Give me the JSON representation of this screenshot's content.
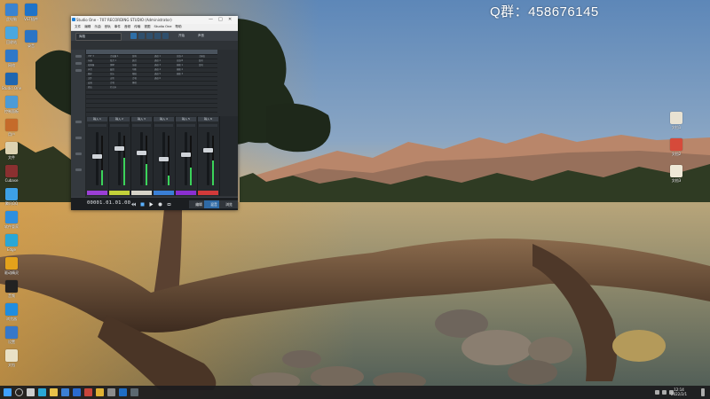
{
  "desktop": {
    "watermark": "Q群：458676145",
    "icons_left": [
      {
        "label": "此电脑",
        "color": "#3a83d1"
      },
      {
        "label": "回收站",
        "color": "#4aa7e0"
      },
      {
        "label": "网络",
        "color": "#2f78c8"
      },
      {
        "label": "Studio One",
        "color": "#1e66b0"
      },
      {
        "label": "控制面板",
        "color": "#4c9bd6"
      },
      {
        "label": "用户",
        "color": "#c56b2a"
      },
      {
        "label": "文件",
        "color": "#ddd3b2"
      },
      {
        "label": "Cubase",
        "color": "#8a3030"
      },
      {
        "label": "腾讯QQ",
        "color": "#3da0e6"
      },
      {
        "label": "软件管家",
        "color": "#2e8fe0"
      },
      {
        "label": "Edge",
        "color": "#2aa7d6"
      },
      {
        "label": "驱动精灵",
        "color": "#e3a21b"
      },
      {
        "label": "音频",
        "color": "#222222"
      },
      {
        "label": "浏览器",
        "color": "#1f8de0"
      },
      {
        "label": "设置",
        "color": "#3778c9"
      },
      {
        "label": "文档",
        "color": "#e9e1c6"
      }
    ],
    "icons_left2": [
      {
        "label": "VST插件",
        "color": "#1e73c9"
      },
      {
        "label": "录音",
        "color": "#2b74c4"
      }
    ],
    "icons_right": [
      {
        "label": "文档1",
        "color": "#e8e2d2"
      },
      {
        "label": "文档2",
        "color": "#d64a3a"
      },
      {
        "label": "文档3",
        "color": "#eee8d6"
      }
    ]
  },
  "window": {
    "title": "Studio One - 707 RECORDING STUDIO (Administrator)",
    "controls": {
      "minimize": "—",
      "maximize": "□",
      "close": "✕"
    },
    "menu": [
      "文件",
      "编辑",
      "乐曲",
      "音轨",
      "事件",
      "音频",
      "传输",
      "视图",
      "Studio One",
      "帮助"
    ],
    "toolbar": {
      "preset": "库路",
      "indicator": "开始",
      "sound": "声音"
    },
    "grid_columns": [
      {
        "header": "",
        "rows": [
          "VST 3",
          "乐器",
          "效果器",
          "声音",
          "循环",
          "文件",
          "云端",
          "商店",
          "",
          "",
          "",
          "",
          ""
        ]
      },
      {
        "header": "",
        "rows": [
          "合成器 1",
          "低音 1",
          "钢琴",
          "鼓组",
          "弦乐",
          "吉他",
          "合唱",
          "打击乐",
          "",
          "",
          "",
          "",
          ""
        ]
      },
      {
        "header": "",
        "rows": [
          "混响",
          "延迟",
          "压缩",
          "均衡",
          "限幅",
          "合唱",
          "移相",
          "",
          "",
          "",
          "",
          "",
          ""
        ]
      },
      {
        "header": "",
        "rows": [
          "通道 1",
          "通道 2",
          "通道 3",
          "通道 4",
          "通道 5",
          "通道 6",
          "",
          "",
          "",
          "",
          "",
          "",
          ""
        ]
      },
      {
        "header": "",
        "rows": [
          "总线 A",
          "总线 B",
          "辅助 1",
          "辅助 2",
          "辅助 3",
          "",
          "",
          "",
          "",
          "",
          "",
          "",
          ""
        ]
      },
      {
        "header": "",
        "rows": [
          "主输出",
          "监听",
          "耳机",
          "",
          "",
          "",
          "",
          "",
          "",
          "",
          "",
          "",
          ""
        ]
      }
    ],
    "mixer": {
      "channels": [
        {
          "name": "输入 1",
          "label": "",
          "label_color": "#9b3fd6",
          "fader": 0.55,
          "level": 0.3
        },
        {
          "name": "输入 2",
          "label": "",
          "label_color": "#c4d23a",
          "fader": 0.7,
          "level": 0.55
        },
        {
          "name": "输入 3",
          "label": "",
          "label_color": "#d7d4c8",
          "fader": 0.62,
          "level": 0.42
        },
        {
          "name": "输入 4",
          "label": "",
          "label_color": "#3a7fd6",
          "fader": 0.5,
          "level": 0.2
        },
        {
          "name": "输入 5",
          "label": "",
          "label_color": "#8a2fd1",
          "fader": 0.58,
          "level": 0.35
        },
        {
          "name": "输入 6",
          "label": "",
          "label_color": "#d23a3a",
          "fader": 0.66,
          "level": 0.5
        }
      ]
    },
    "transport": {
      "time": "00001.01.01.00",
      "buttons": [
        "编辑",
        "混音",
        "浏览"
      ]
    }
  },
  "taskbar": {
    "time": "12:14",
    "date": "2022/2/1",
    "apps": [
      {
        "name": "start",
        "color": "#3fa0ff"
      },
      {
        "name": "search",
        "color": "#bdbdbd"
      },
      {
        "name": "task-view",
        "color": "#cccccc"
      },
      {
        "name": "edge",
        "color": "#2aa7d6"
      },
      {
        "name": "explorer",
        "color": "#e7c04a"
      },
      {
        "name": "store",
        "color": "#3b7fd4"
      },
      {
        "name": "mail",
        "color": "#2a6bd0"
      },
      {
        "name": "app-red",
        "color": "#c7453b"
      },
      {
        "name": "app-yellow",
        "color": "#dfb133"
      },
      {
        "name": "app-gray",
        "color": "#8b8b8b"
      },
      {
        "name": "studio-one",
        "color": "#1f6dc4"
      },
      {
        "name": "app-dark",
        "color": "#5c6870"
      }
    ]
  }
}
